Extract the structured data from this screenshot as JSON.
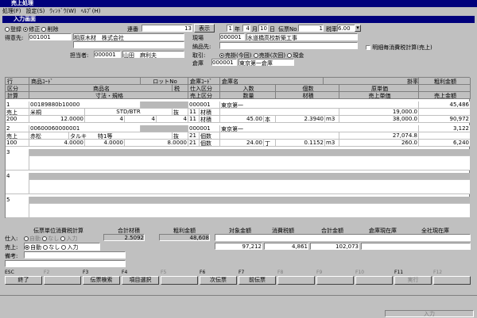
{
  "app": {
    "title": "売上処理",
    "menu": [
      "処理(F)",
      "設定(S)",
      "ｳｨﾝﾄﾞｳ(W)",
      "ﾍﾙﾌﾟ(H)"
    ]
  },
  "sub": {
    "title": "入力画面"
  },
  "mode": {
    "options": [
      "登録",
      "修正",
      "削除"
    ],
    "selected": 1
  },
  "slip": {
    "denpyo_label": "連番",
    "denpyo_value": "13",
    "show_button": "表示",
    "year": "1",
    "year_label": "年",
    "month": "4",
    "month_label": "月",
    "day": "10",
    "day_label": "日",
    "slipno_label": "伝票No",
    "slipno_value": "1",
    "taxrate_label": "税率",
    "taxrate_value": "6.00"
  },
  "customer": {
    "label": "得意先:",
    "code": "001001",
    "name": "相原木材　株式会社",
    "tanto_label": "担当者:",
    "tanto_code": "000001",
    "tanto_name": "山田　麻利夫"
  },
  "site": {
    "genba_label": "現場",
    "genba_code": "000001",
    "genba_name": "水道橋高校新築工事",
    "nohin_label": "納品先:",
    "torihiki_label": "取引:",
    "torihiki_options": [
      "売掛(今回)",
      "売掛(次回)",
      "現金"
    ],
    "torihiki_selected": 0,
    "soko_label": "倉庫",
    "soko_code": "000001",
    "soko_name": "東京第一倉庫",
    "meisai_checkbox": "明細毎消費税計算(売上)"
  },
  "grid": {
    "headers": {
      "gyo": "行",
      "kubun": "区分",
      "keisan": "計算",
      "shohin_code": "商品ｺｰﾄﾞ",
      "lot": "ロットNo",
      "soko_code": "倉庫ｺｰﾄﾞ",
      "soko_mei": "倉庫名",
      "kakeritsu": "掛率",
      "arari": "粗利金額",
      "shohin_mei": "商品名",
      "zei": "税",
      "shiire_kubun": "仕入区分",
      "iri": "入数",
      "kosu": "個数",
      "genka": "原単価",
      "sunpo": "寸法・規格",
      "uriage_kubun": "売上区分",
      "suryo": "数量",
      "zaiseki": "材積",
      "uriage_tanka": "売上単価",
      "uriage_kingaku": "売上金額"
    },
    "rows": [
      {
        "no": "1",
        "kubun": "売上",
        "keisan": "200",
        "code": "00189880b10000",
        "name": "米桐",
        "spec1": "12.0000",
        "spec2": "4",
        "spec3": "4",
        "spec4": "4",
        "std": "STD/BTR",
        "zei": "抜",
        "soko": "000001",
        "soko_name": "東京第一",
        "sk": "11",
        "sk_name": "材積",
        "uk": "11",
        "uk_name": "材積",
        "suryo": "45.00",
        "unit": "本",
        "zaiseki": "2.3940",
        "zunit": "m3",
        "genka": "19,000.0",
        "tanka": "38,000.0",
        "arari": "45,486",
        "kingaku": "90,972"
      },
      {
        "no": "2",
        "kubun": "売上",
        "keisan": "100",
        "code": "00600060000001",
        "name": "赤松",
        "spec1": "4.0000",
        "spec2": "4.0000",
        "spec3": "8.0000",
        "spec4": "",
        "std": "タルキ　　特1等",
        "zei": "抜",
        "soko": "000001",
        "soko_name": "東京第一",
        "sk": "21",
        "sk_name": "個数",
        "uk": "21",
        "uk_name": "個数",
        "suryo": "24.00",
        "unit": "丁",
        "zaiseki": "0.1152",
        "zunit": "m3",
        "genka": "27,074.8",
        "tanka": "260.0",
        "arari": "3,122",
        "kingaku": "6,240"
      },
      {
        "no": "3"
      },
      {
        "no": "4"
      },
      {
        "no": "5"
      }
    ]
  },
  "totals": {
    "headers": [
      "伝票単位消費税計算",
      "合計材積",
      "粗利金額",
      "対象金額",
      "消費税額",
      "合計金額",
      "倉庫現在庫",
      "全社現在庫"
    ],
    "shiire_label": "仕入:",
    "uriage_label": "売上:",
    "bikou_label": "備考:",
    "shiire_opts": [
      "自動",
      "なし",
      "入力"
    ],
    "uriage_opts": [
      "自動",
      "なし",
      "入力"
    ],
    "uriage_selected": 0,
    "zaiseki": "2.5092",
    "arari": "48,608",
    "taisho": "97,212",
    "tax": "4,861",
    "gokei": "102,073"
  },
  "fkeys": [
    {
      "k": "ESC",
      "l": "終了"
    },
    {
      "k": "F2",
      "l": ""
    },
    {
      "k": "F3",
      "l": "伝票検索"
    },
    {
      "k": "F4",
      "l": "項目選択"
    },
    {
      "k": "F5",
      "l": ""
    },
    {
      "k": "F6",
      "l": "次伝票"
    },
    {
      "k": "F7",
      "l": "前伝票"
    },
    {
      "k": "F8",
      "l": ""
    },
    {
      "k": "F9",
      "l": ""
    },
    {
      "k": "F10",
      "l": ""
    },
    {
      "k": "F11",
      "l": "実行"
    },
    {
      "k": "F12",
      "l": ""
    }
  ],
  "status": {
    "text": "入力"
  }
}
